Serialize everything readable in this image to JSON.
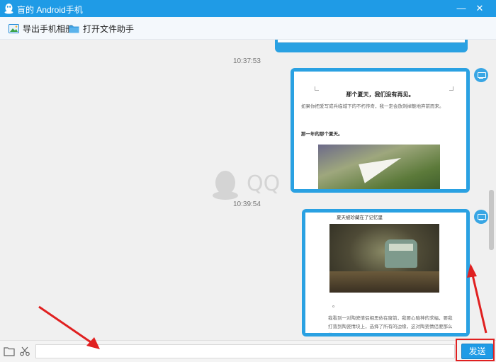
{
  "window": {
    "title": "盲的 Android手机",
    "minimize_label": "—",
    "close_label": "✕",
    "accent_color": "#1f9be6"
  },
  "toolbar": {
    "export_label": "导出手机相册",
    "export_icon": "photo-export-icon",
    "open_label": "打开文件助手",
    "open_icon": "folder-icon"
  },
  "chat": {
    "timestamps": [
      "10:37:53",
      "10:39:54"
    ],
    "watermark": "QQ",
    "message1": {
      "title": "那个夏天，我们没有再见。",
      "paragraph": "如果你把爱写成兵临城下的不朽传奇，我一定会放刺掉魅地弃前而来。",
      "subtitle": "那一年的那个夏天。"
    },
    "message2": {
      "heading": "夏天被珍藏在了记忆里",
      "mark": "。",
      "paragraph": "我看到一对陶瓷情侣相思依在窗前，我要心暗神的求幅，要我打落到陶瓷情块上，选择了所有的边缘，这对陶瓷情侣要那么的"
    }
  },
  "input": {
    "value": "",
    "placeholder": "",
    "send_label": "发送"
  }
}
